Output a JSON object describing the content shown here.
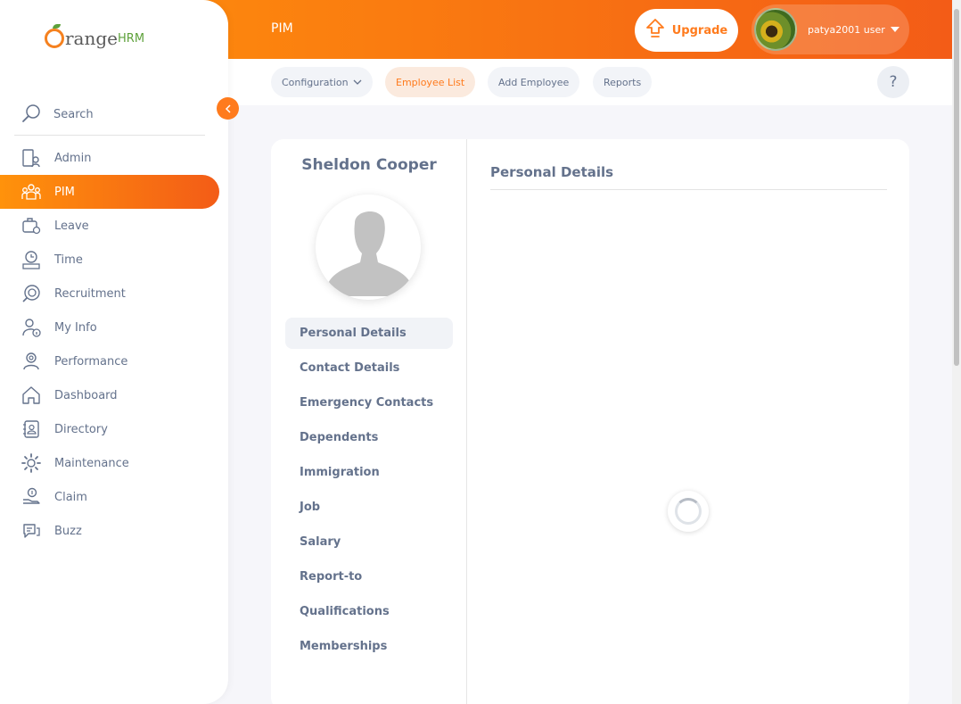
{
  "header": {
    "title": "PIM",
    "upgrade_label": "Upgrade",
    "user_name": "patya2001 user"
  },
  "brand": {
    "logo_part1": "range",
    "logo_part2": "HRM"
  },
  "subnav": {
    "tabs": [
      {
        "label": "Configuration"
      },
      {
        "label": "Employee List"
      },
      {
        "label": "Add Employee"
      },
      {
        "label": "Reports"
      }
    ],
    "help_label": "?"
  },
  "sidebar": {
    "search_label": "Search",
    "items": [
      {
        "label": "Admin"
      },
      {
        "label": "PIM"
      },
      {
        "label": "Leave"
      },
      {
        "label": "Time"
      },
      {
        "label": "Recruitment"
      },
      {
        "label": "My Info"
      },
      {
        "label": "Performance"
      },
      {
        "label": "Dashboard"
      },
      {
        "label": "Directory"
      },
      {
        "label": "Maintenance"
      },
      {
        "label": "Claim"
      },
      {
        "label": "Buzz"
      }
    ]
  },
  "employee": {
    "name": "Sheldon Cooper",
    "tabs": [
      {
        "label": "Personal Details"
      },
      {
        "label": "Contact Details"
      },
      {
        "label": "Emergency Contacts"
      },
      {
        "label": "Dependents"
      },
      {
        "label": "Immigration"
      },
      {
        "label": "Job"
      },
      {
        "label": "Salary"
      },
      {
        "label": "Report-to"
      },
      {
        "label": "Qualifications"
      },
      {
        "label": "Memberships"
      }
    ],
    "section_title": "Personal Details"
  },
  "colors": {
    "accent": "#ff7b1d",
    "gradient_start": "#ff920b",
    "gradient_end": "#f35c17",
    "text": "#64728c"
  }
}
